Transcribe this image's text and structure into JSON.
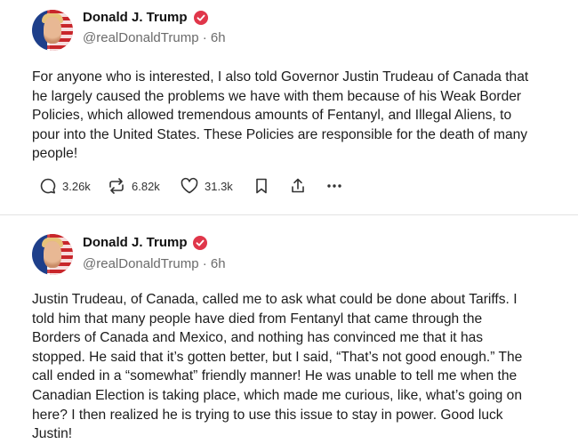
{
  "posts": [
    {
      "author": "Donald J. Trump",
      "handle": "@realDonaldTrump",
      "time": "6h",
      "text": "For anyone who is interested, I also told Governor Justin Trudeau of Canada that\nhe largely caused the problems we have with them because of his Weak Border\nPolicies, which allowed tremendous amounts of Fentanyl, and Illegal Aliens, to\npour into the United States. These Policies are responsible for the death of many\npeople!",
      "replies": "3.26k",
      "retruths": "6.82k",
      "likes": "31.3k"
    },
    {
      "author": "Donald J. Trump",
      "handle": "@realDonaldTrump",
      "time": "6h",
      "text": "Justin Trudeau, of Canada, called me to ask what could be done about Tariffs. I\ntold him that many people have died from Fentanyl that came through the\nBorders of Canada and Mexico, and nothing has convinced me that it has\nstopped. He said that it’s gotten better, but I said, “That’s not good enough.” The\ncall ended in a “somewhat” friendly manner! He was unable to tell me when the\nCanadian Election is taking place, which made me curious, like, what’s going on\nhere? I then realized he is trying to use this issue to stay in power. Good luck\nJustin!"
    }
  ],
  "separator": " · ",
  "icons": {
    "verified": "verified-badge-icon",
    "reply": "reply-icon",
    "retruth": "retruth-icon",
    "like": "like-icon",
    "bookmark": "bookmark-icon",
    "share": "share-icon",
    "more": "more-icon"
  },
  "colors": {
    "verified": "#e0364a",
    "muted": "#6b6b6b"
  }
}
